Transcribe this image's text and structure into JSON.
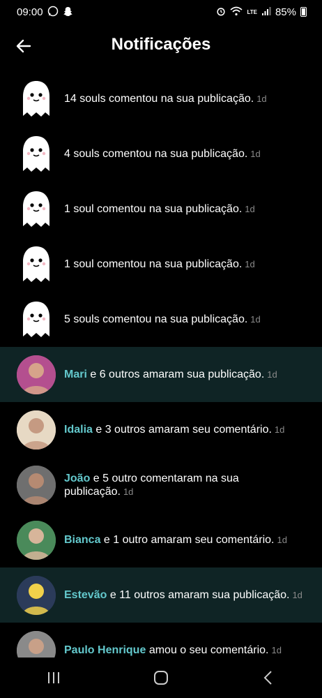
{
  "status": {
    "time": "09:00",
    "battery": "85%",
    "net": "LTE"
  },
  "header": {
    "title": "Notificações"
  },
  "notifications": [
    {
      "type": "ghost",
      "name": "",
      "text": "14 souls comentou na sua publicação.",
      "time": "1d",
      "hl": false
    },
    {
      "type": "ghost",
      "name": "",
      "text": "4 souls comentou na sua publicação.",
      "time": "1d",
      "hl": false
    },
    {
      "type": "ghost",
      "name": "",
      "text": "1 soul comentou na sua publicação.",
      "time": "1d",
      "hl": false
    },
    {
      "type": "ghost",
      "name": "",
      "text": "1 soul comentou na sua publicação.",
      "time": "1d",
      "hl": false
    },
    {
      "type": "ghost",
      "name": "",
      "text": "5 souls comentou na sua publicação.",
      "time": "1d",
      "hl": false
    },
    {
      "type": "avatar",
      "name": "Mari",
      "text": "e 6 outros amaram sua publicação.",
      "time": "1d",
      "hl": true
    },
    {
      "type": "avatar",
      "name": "Idalia",
      "text": "e 3 outros amaram seu comentário.",
      "time": "1d",
      "hl": false
    },
    {
      "type": "avatar",
      "name": "João",
      "text": "e 5 outro comentaram na sua publicação.",
      "time": "1d",
      "hl": false
    },
    {
      "type": "avatar",
      "name": "Bianca",
      "text": "e 1 outro amaram seu comentário.",
      "time": "1d",
      "hl": false
    },
    {
      "type": "avatar",
      "name": "Estevão",
      "text": "e 11 outros amaram sua publicação.",
      "time": "1d",
      "hl": true
    },
    {
      "type": "avatar",
      "name": "Paulo Henrique",
      "text": "amou o seu comentário.",
      "time": "1d",
      "hl": false
    }
  ],
  "colors": {
    "highlight_bg": "#0f2425",
    "name_color": "#63c8cc",
    "time_color": "#8a8a8a"
  },
  "icons": {
    "back": "arrow-left-icon",
    "ghost": "ghost-icon",
    "recents": "recents-icon",
    "home": "home-icon",
    "nav_back": "chevron-left-icon"
  }
}
